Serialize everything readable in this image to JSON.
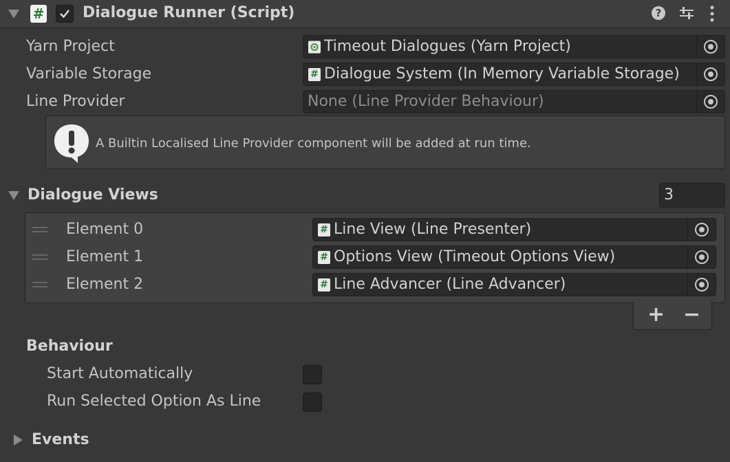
{
  "component": {
    "title": "Dialogue Runner (Script)",
    "script_icon": "#"
  },
  "fields": {
    "yarn_project": {
      "label": "Yarn Project",
      "value": "Timeout Dialogues (Yarn Project)"
    },
    "variable_storage": {
      "label": "Variable Storage",
      "value": "Dialogue System (In Memory Variable Storage)"
    },
    "line_provider": {
      "label": "Line Provider",
      "value": "None (Line Provider Behaviour)"
    }
  },
  "help_message": "A Builtin Localised Line Provider component will be added at run time.",
  "dialogue_views": {
    "label": "Dialogue Views",
    "count": "3",
    "elements": [
      {
        "label": "Element 0",
        "value": "Line View (Line Presenter)"
      },
      {
        "label": "Element 1",
        "value": "Options View (Timeout Options View)"
      },
      {
        "label": "Element 2",
        "value": "Line Advancer (Line Advancer)"
      }
    ],
    "add_label": "+",
    "remove_label": "−"
  },
  "behaviour": {
    "label": "Behaviour",
    "start_automatically": "Start Automatically",
    "run_selected_option": "Run Selected Option As Line"
  },
  "events": {
    "label": "Events"
  },
  "colors": {
    "background": "#383838",
    "field": "#2a2a2a",
    "script_green": "#2c7a3c"
  }
}
